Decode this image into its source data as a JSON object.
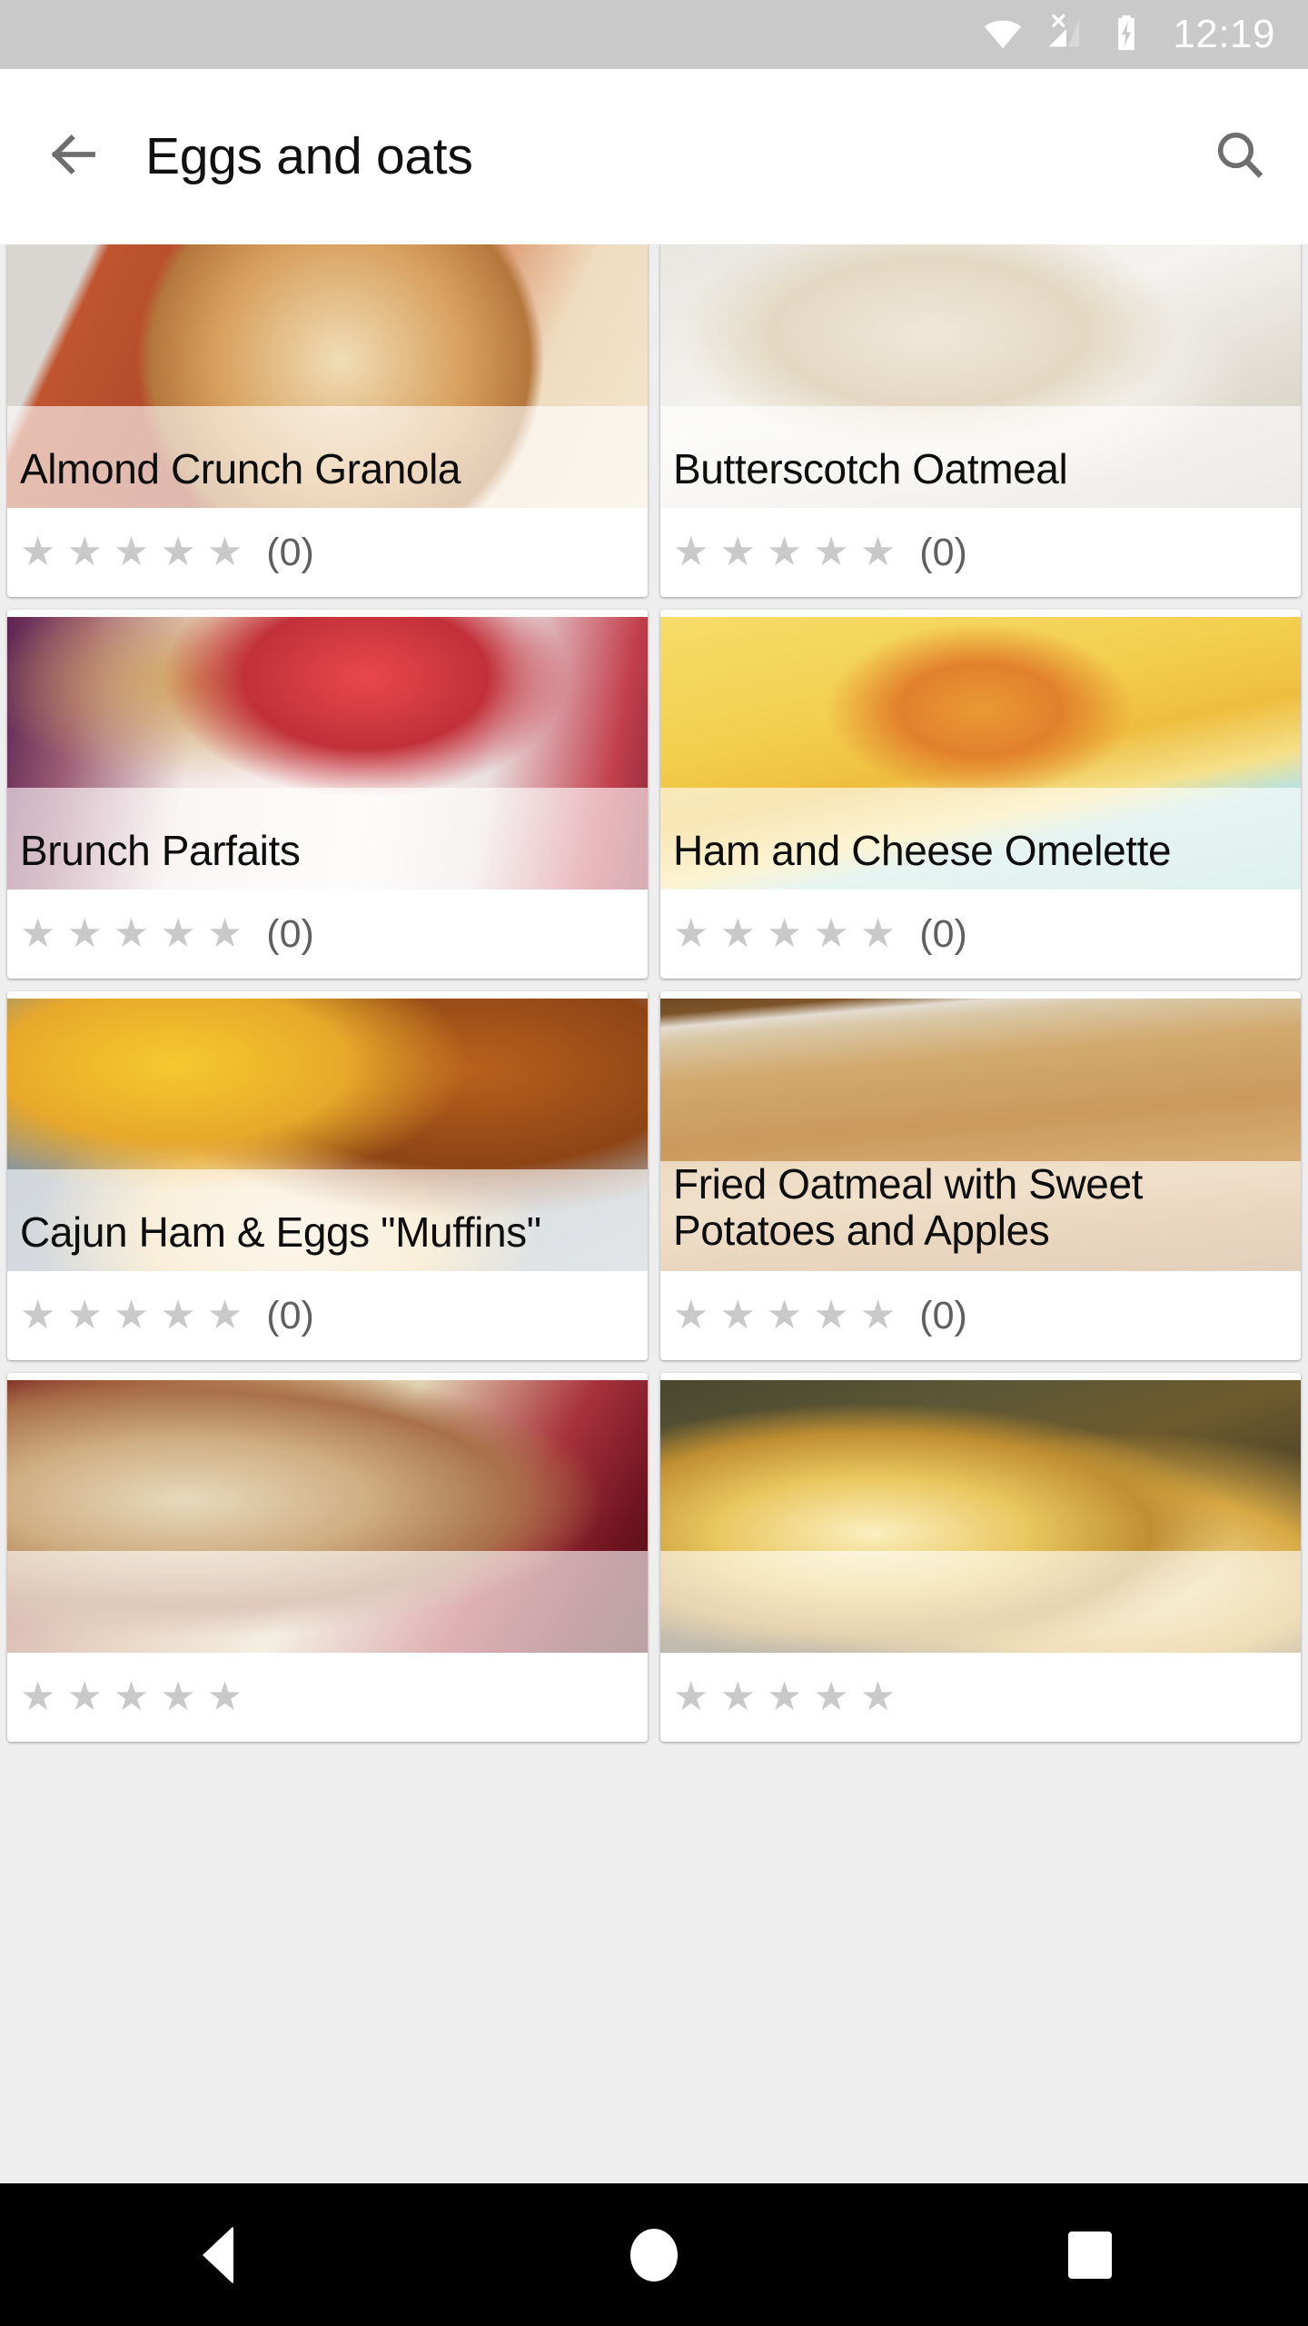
{
  "status_bar": {
    "time": "12:19",
    "icons": [
      "wifi-icon",
      "cellular-no-signal-icon",
      "battery-charging-icon"
    ],
    "background_color": "#c9c9c9"
  },
  "app_bar": {
    "back_icon": "arrow-back-icon",
    "title": "Eggs and oats",
    "search_icon": "search-icon",
    "background_color": "#ffffff",
    "title_color": "#111111"
  },
  "recipes": [
    {
      "title": "Almond Crunch Granola",
      "rating_stars": 5,
      "rating_filled": 0,
      "review_count": "(0)",
      "image": "almond-crunch-granola-photo",
      "colors": [
        "#b8502c",
        "#e8c69a",
        "#f2ddbe",
        "#c97a42"
      ]
    },
    {
      "title": "Butterscotch Oatmeal",
      "rating_stars": 5,
      "rating_filled": 0,
      "review_count": "(0)",
      "image": "butterscotch-oatmeal-photo",
      "colors": [
        "#dddbd6",
        "#f0ece4",
        "#e8e3d6",
        "#cfcac0"
      ]
    },
    {
      "title": "Brunch Parfaits",
      "rating_stars": 5,
      "rating_filled": 0,
      "review_count": "(0)",
      "image": "brunch-parfaits-photo",
      "colors": [
        "#6b2a52",
        "#efe2e4",
        "#d94f52",
        "#c9a06a"
      ]
    },
    {
      "title": "Ham and Cheese Omelette",
      "rating_stars": 5,
      "rating_filled": 0,
      "review_count": "(0)",
      "image": "ham-and-cheese-omelette-photo",
      "colors": [
        "#f5d04e",
        "#e8a33a",
        "#b7dfd8",
        "#f7e7a0"
      ]
    },
    {
      "title": "Cajun Ham & Eggs \"Muffins\"",
      "rating_stars": 5,
      "rating_filled": 0,
      "review_count": "(0)",
      "image": "cajun-ham-eggs-muffins-photo",
      "colors": [
        "#8d98a3",
        "#f2c12e",
        "#c2661f",
        "#e8dcc8"
      ]
    },
    {
      "title": "Fried Oatmeal with Sweet Potatoes and Apples",
      "rating_stars": 5,
      "rating_filled": 0,
      "review_count": "(0)",
      "image": "fried-oatmeal-sweet-potatoes-apples-photo",
      "colors": [
        "#6b4a2a",
        "#d9a96c",
        "#c98f52",
        "#e8d2ae"
      ]
    },
    {
      "title": "",
      "rating_stars": 5,
      "rating_filled": 0,
      "review_count": "",
      "image": "apple-cinnamon-oatmeal-photo",
      "colors": [
        "#7a1f25",
        "#a8583a",
        "#e0cdae",
        "#521018"
      ]
    },
    {
      "title": "",
      "rating_stars": 5,
      "rating_filled": 0,
      "review_count": "",
      "image": "french-toast-photo",
      "colors": [
        "#3b3a2c",
        "#c98a2e",
        "#e8c15a",
        "#7a5a20"
      ]
    }
  ],
  "star_glyph": "★",
  "nav_bar": {
    "back_label": "back-triangle-icon",
    "home_label": "home-circle-icon",
    "recents_label": "recents-square-icon",
    "background_color": "#000000"
  },
  "theme": {
    "card_background": "#ffffff",
    "page_background": "#eeeeef",
    "star_color": "#c9c9c9",
    "count_color": "#5f5f5f",
    "title_overlay": "rgba(255,255,255,0.62)"
  }
}
